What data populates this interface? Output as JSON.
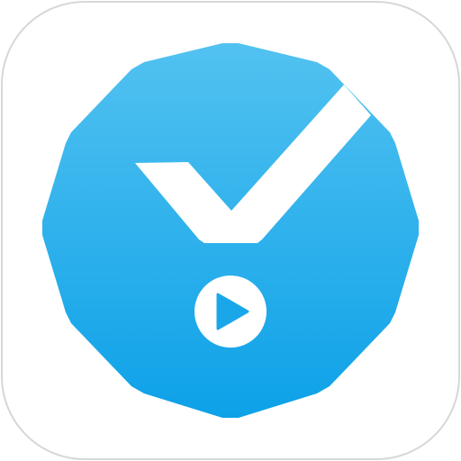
{
  "icon": {
    "name": "video-check-app-icon",
    "colors": {
      "tile_background": "#ffffff",
      "tile_border": "#d7d7d7",
      "badge_gradient_top": "#52c2f0",
      "badge_gradient_bottom": "#0da1e8",
      "checkmark": "#ffffff",
      "play_circle": "#ffffff",
      "play_triangle": "#1aa7ea"
    }
  }
}
